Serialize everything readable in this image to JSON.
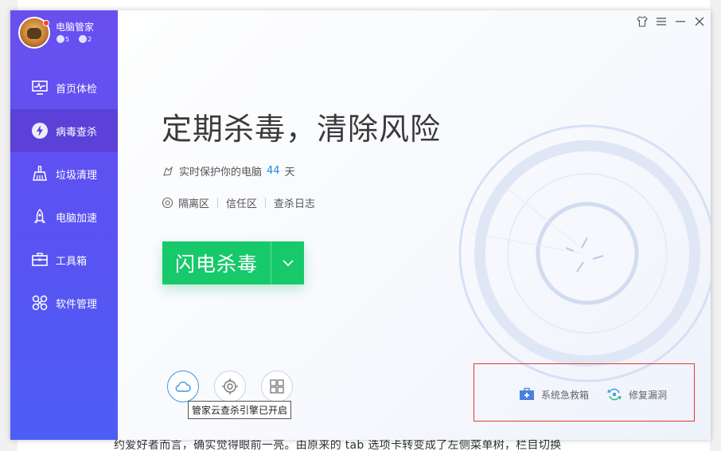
{
  "background_doc": {
    "text": "约爱好者而言，确实觉得眼前一亮。由原来的 tab 选项卡转变成了左侧菜单树，栏目切换"
  },
  "app": {
    "name": "电脑管家",
    "badges": [
      "5",
      "2"
    ]
  },
  "sidebar": {
    "items": [
      {
        "label": "首页体检",
        "icon": "monitor-icon"
      },
      {
        "label": "病毒查杀",
        "icon": "lightning-shield-icon",
        "active": true
      },
      {
        "label": "垃圾清理",
        "icon": "broom-icon"
      },
      {
        "label": "电脑加速",
        "icon": "rocket-icon"
      },
      {
        "label": "工具箱",
        "icon": "toolbox-icon"
      },
      {
        "label": "软件管理",
        "icon": "software-icon"
      }
    ]
  },
  "titlebar": {
    "buttons": [
      "skin-icon",
      "menu-icon",
      "minimize-icon",
      "close-icon"
    ]
  },
  "main": {
    "headline": "定期杀毒，清除风险",
    "protect_prefix": "实时保护你的电脑",
    "protect_days": "44",
    "protect_suffix": "天",
    "links": [
      "隔离区",
      "信任区",
      "查杀日志"
    ],
    "scan_button": "闪电杀毒",
    "engines": [
      "cloud-icon",
      "target-icon",
      "windows-icon"
    ],
    "tooltip": "管家云查杀引擎已开启",
    "tools": [
      "系统急救箱",
      "修复漏洞"
    ]
  },
  "colors": {
    "sidebar_top": "#6a4ff0",
    "sidebar_bottom": "#4d5ef4",
    "active_item": "#5b41d8",
    "scan_green": "#17c96b",
    "accent_blue": "#1e88e5",
    "highlight_red": "#e53935"
  }
}
